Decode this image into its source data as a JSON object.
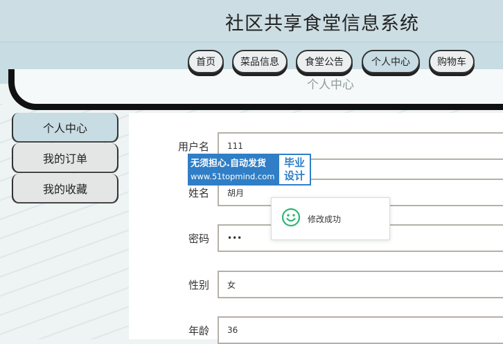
{
  "app": {
    "title": "社区共享食堂信息系统"
  },
  "nav": {
    "items": [
      "首页",
      "菜品信息",
      "食堂公告",
      "个人中心",
      "购物车"
    ],
    "active": "个人中心",
    "ghost_text": "个人中心"
  },
  "sidebar": {
    "items": [
      "个人中心",
      "我的订单",
      "我的收藏"
    ],
    "active": "个人中心"
  },
  "form": {
    "username_label": "用户名",
    "username_value": "111",
    "name_label": "姓名",
    "name_value": "胡月",
    "password_label": "密码",
    "password_value": "•••",
    "gender_label": "性别",
    "gender_value": "女",
    "age_label": "年龄",
    "age_value": "36"
  },
  "toast": {
    "text": "修改成功",
    "icon": "smile-icon",
    "color": "#2bb673"
  },
  "watermark": {
    "line1": "无须担心.自动发货",
    "line2": "www.51topmind.com",
    "right_line1": "毕业",
    "right_line2": "设计"
  }
}
